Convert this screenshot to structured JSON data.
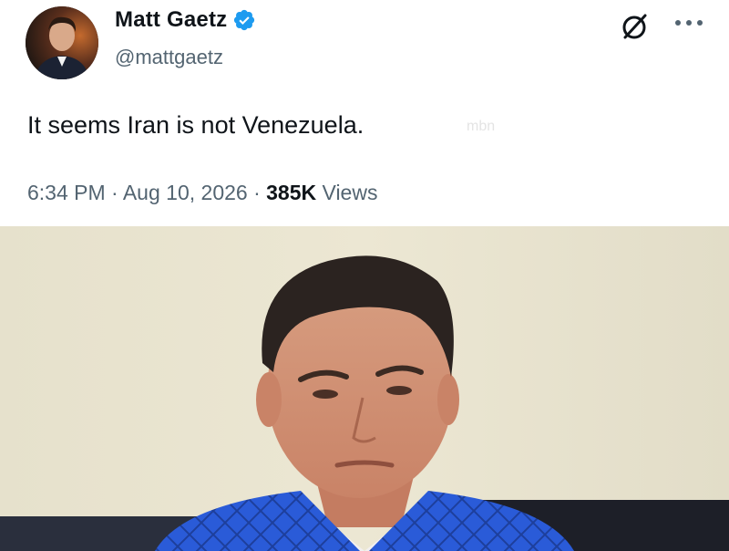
{
  "author": {
    "name": "Matt Gaetz",
    "handle": "@mattgaetz",
    "verified_color": "#1d9bf0"
  },
  "tweet": {
    "text": "It seems Iran is not Venezuela.",
    "watermark": "mbn",
    "time": "6:34 PM",
    "separator": "·",
    "date": "Aug 10, 2026",
    "views_count": "385K",
    "views_label": "Views"
  },
  "icons": {
    "verified": "verified-badge-icon",
    "grok": "grok-icon",
    "more": "more-options-icon"
  },
  "colors": {
    "text_primary": "#0f1419",
    "text_secondary": "#536471",
    "verified_blue": "#1d9bf0",
    "photo_wall": "#e8e3cf",
    "suit_blue": "#2a5bd8"
  }
}
